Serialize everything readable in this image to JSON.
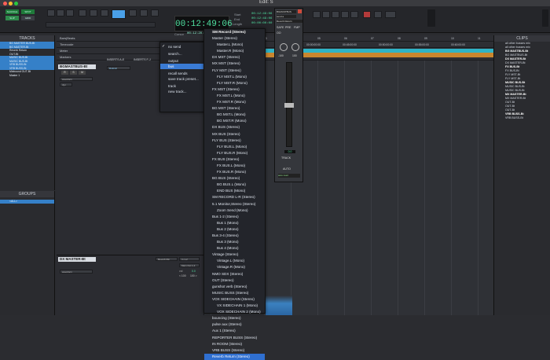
{
  "window": {
    "title": "Edit: S"
  },
  "toolbar": {
    "mode_buttons": [
      "SHUFFLE",
      "SPOT",
      "SLIP",
      "GRID"
    ],
    "counter": "00:12:49:06",
    "start_label": "Start",
    "end_label": "End",
    "length_label": "Length",
    "start_value": "00:12:49:06",
    "end_value": "00:12:49:06",
    "length_value": "00:00:00:00",
    "cursor_label": "Cursor",
    "cursor_value": "00:12:20:20:27",
    "icons": [
      "zoom-icon",
      "trim-icon",
      "selector-icon",
      "grabber-icon",
      "smart-tool-icon",
      "pencil-icon",
      "play-icon",
      "stop-icon",
      "rewind-icon",
      "forward-icon",
      "record-icon",
      "loop-icon"
    ]
  },
  "tracks_panel": {
    "header": "TRACKS",
    "items": [
      "BG MASTER BUS-Bt",
      "BG MASTER-Bt",
      "Reverb Return",
      "OUT-Bt",
      "MUSIC BUS-Bt",
      "MUSIC BUS-Bt",
      "VRB BUSS-Bt",
      "VRB BUSS-Bt",
      "Mixbound OUT-Bt",
      "Master 1"
    ]
  },
  "groups_panel": {
    "header": "GROUPS",
    "items": [
      "<ALL>"
    ]
  },
  "rulers": [
    "Bars|Beats",
    "Timecode",
    "Meter",
    "Markers"
  ],
  "timeline_ticks": [
    "00:00:00:00",
    "00:45:00:00",
    "00:50:00:00",
    "00:55:00:00",
    "00:60:00:00",
    "01:00",
    "02",
    "03",
    "04",
    "05",
    "06",
    "07",
    "08",
    "09",
    "10",
    "11"
  ],
  "track_top": {
    "name": "BGMASTBUS-Bt",
    "inserts_ae": "INSERTS A-E",
    "inserts_fj": "INSERTS F-J",
    "sends_ae": "SENDS A-E",
    "insert1": "Dolonic",
    "view": "waveform",
    "buttons": [
      "R",
      "S",
      "M"
    ],
    "dyn": "dyn"
  },
  "track_bottom": {
    "name": "DX MASTER-Bt",
    "view": "waveform",
    "sends": "Reverb Rtn",
    "io_in": "In 1-2",
    "io_out": "Main Out 1-2",
    "vol": "vol",
    "vol_value": "0.0",
    "pan_left": "< 100",
    "pan_right": "100 >"
  },
  "send_menu": {
    "items": [
      "no send",
      "search...",
      "output",
      "bus",
      "recall sends",
      "save track preset...",
      "track",
      "new track..."
    ],
    "checked": "no send",
    "highlighted": "bus"
  },
  "bus_menu": {
    "items": [
      "SM Record (Stereo)",
      "Master (Stereo)",
      "Master.L (Mono)",
      "Master.R (Mono)",
      "DX MST (Stereo)",
      "MX MST (Stereo)",
      "FLY MST (Stereo)",
      "FLY MST.L (Mono)",
      "FLY MST.R (Mono)",
      "FX MST (Stereo)",
      "FX MST.L (Mono)",
      "FX MST.R (Mono)",
      "BG MST (Stereo)",
      "BG MST.L (Mono)",
      "BG MST.R (Mono)",
      "DX BUS (Stereo)",
      "MX BUS (Stereo)",
      "FLY BUS (Stereo)",
      "FLY BUS.L (Mono)",
      "FLY BUS.R (Mono)",
      "FX BUS (Stereo)",
      "FX BUS.L (Mono)",
      "FX BUS.R (Mono)",
      "BG BUS (Stereo)",
      "BG BUS.L (Mono)",
      "END BUS (Mono)",
      "SM RECORD L-R (Stereo)",
      "5.1 Monitor,Stereo (Stereo)",
      "Zoom Send (Mono)",
      "Bus 1-2 (Stereo)",
      "Bus 1 (Mono)",
      "Bus 2 (Mono)",
      "Bus 3-4 (Stereo)",
      "Bus 3 (Mono)",
      "Bus 4 (Mono)",
      "Vintage (Stereo)",
      "Vintage.L (Mono)",
      "Vintage.R (Mono)",
      "NMO SDX (Stereo)",
      "OUT (Stereo)",
      "gunshot verb (Stereo)",
      "MUSIC BUSS (Stereo)",
      "VOX SIDECHAIN (Stereo)",
      "VX SIDECHAIN 1 (Mono)",
      "VOX SIDECHAIN 2 (Mono)",
      "bouncing (Stereo)",
      "pulse aux (Stereo)",
      "Aux 1 (Stereo)",
      "REPORTER BUSS (Stereo)",
      "IN ROOM (Stereo)",
      "VRB BUSS (Stereo)",
      "Reverb Return (Stereo)"
    ],
    "highlighted": "Reverb Return (Stereo)"
  },
  "send_window": {
    "track": "BGMASTBUS",
    "send": "send a",
    "dest": "Reverb Return",
    "buttons": [
      "SAFE",
      "PRE",
      "FMP",
      "OO"
    ],
    "level": "-100",
    "pan": "100",
    "value": "0.0",
    "track_label": "TRACK",
    "auto_label": "AUTO",
    "auto_mode": "auto read"
  },
  "clips_panel": {
    "header": "CLIPS",
    "items": [
      "all other busses mix",
      "all other busses mix",
      "BG MASTBUS-Bt",
      "BG MASTBUS-Bt",
      "DX MASTER-Bt",
      "DX MASTER-Bt",
      "FX BUS-Bt",
      "FX BUS-Bt",
      "FLY MST-Bt",
      "FLY MST-Bt",
      "MUSIC BUS-Bt",
      "MUSIC BUS-Bt",
      "MUSIC BUS-Bt",
      "MX MASTER-Bt",
      "MX MASTER-Bt",
      "OUT-Bt",
      "OUT-Bt",
      "OUT-Bt",
      "VRB BUSS-Bt",
      "VRB BUSS-Bt"
    ]
  },
  "colors": {
    "accent": "#3580c8",
    "counter": "#4fe0a0",
    "cyan_track": "#2fb3c6",
    "orange_track": "#c9862f",
    "highlight": "#2f6fd0"
  }
}
